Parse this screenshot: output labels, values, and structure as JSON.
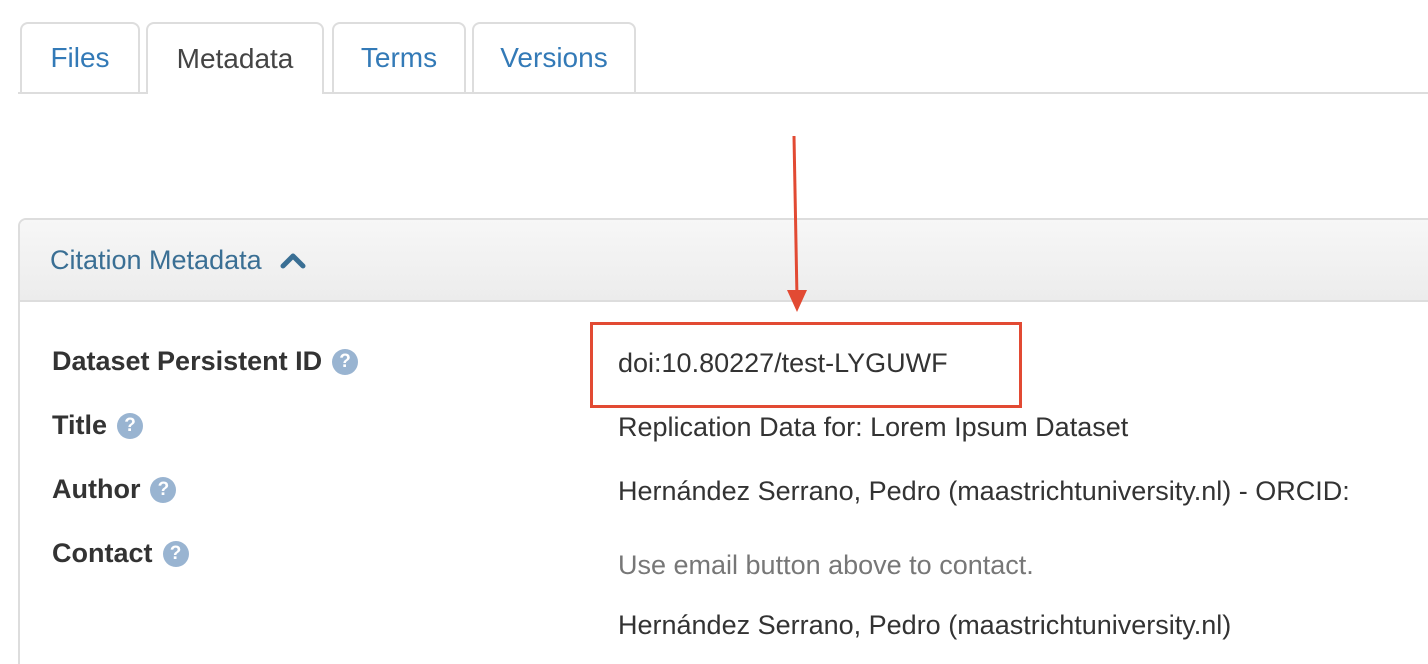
{
  "tabs": [
    {
      "label": "Files",
      "active": false
    },
    {
      "label": "Metadata",
      "active": true
    },
    {
      "label": "Terms",
      "active": false
    },
    {
      "label": "Versions",
      "active": false
    }
  ],
  "panel": {
    "title": "Citation Metadata",
    "caret_icon": "chevron-up-icon"
  },
  "fields": {
    "persistent_id": {
      "label": "Dataset Persistent ID",
      "help_icon": "question-circle-icon",
      "value": "doi:10.80227/test-LYGUWF"
    },
    "title": {
      "label": "Title",
      "help_icon": "question-circle-icon",
      "value": "Replication Data for: Lorem Ipsum Dataset"
    },
    "author": {
      "label": "Author",
      "help_icon": "question-circle-icon",
      "value": "Hernández Serrano, Pedro (maastrichtuniversity.nl) - ORCID:"
    },
    "contact": {
      "label": "Contact",
      "help_icon": "question-circle-icon",
      "note": "Use email button above to contact.",
      "value": "Hernández Serrano, Pedro (maastrichtuniversity.nl)"
    }
  },
  "help_icon_glyph": "?",
  "colors": {
    "link": "#337ab7",
    "annotation": "#e24a33",
    "help_icon": "#99b4d1",
    "panel_title": "#3a6f94"
  }
}
